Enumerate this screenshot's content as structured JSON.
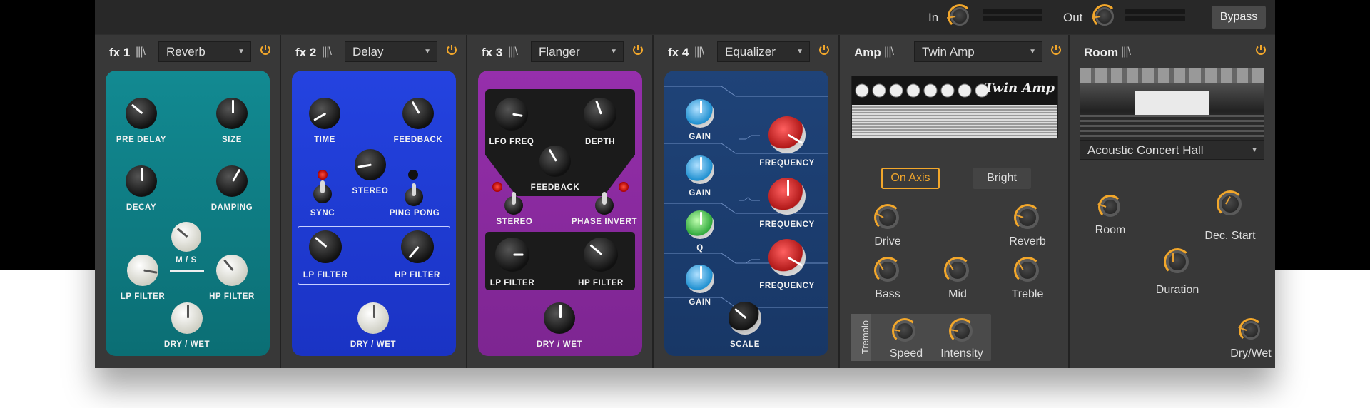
{
  "colors": {
    "accent": "#f2a72b",
    "reverb_pedal": "#0f7f86",
    "delay_pedal": "#1e3ad6",
    "flanger_pedal": "#8c2a9f",
    "eq_pedal": "#1d3d6e"
  },
  "topbar": {
    "in_label": "In",
    "out_label": "Out",
    "bypass_label": "Bypass"
  },
  "fx1": {
    "label": "fx 1",
    "grip": "|||\\",
    "preset": "Reverb",
    "knobs": {
      "pre_delay": "PRE DELAY",
      "size": "SIZE",
      "decay": "DECAY",
      "damping": "DAMPING",
      "ms": "M / S",
      "lp_filter": "LP FILTER",
      "hp_filter": "HP FILTER",
      "dry_wet": "DRY / WET"
    }
  },
  "fx2": {
    "label": "fx 2",
    "grip": "|||\\",
    "preset": "Delay",
    "knobs": {
      "time": "TIME",
      "feedback": "FEEDBACK",
      "stereo": "STEREO",
      "sync": "SYNC",
      "ping_pong": "PING PONG",
      "lp_filter": "LP FILTER",
      "hp_filter": "HP FILTER",
      "dry_wet": "DRY / WET"
    }
  },
  "fx3": {
    "label": "fx 3",
    "grip": "|||\\",
    "preset": "Flanger",
    "knobs": {
      "lfo_freq": "LFO FREQ",
      "depth": "DEPTH",
      "feedback": "FEEDBACK",
      "stereo": "STEREO",
      "phase_invert": "PHASE INVERT",
      "lp_filter": "LP FILTER",
      "hp_filter": "HP FILTER",
      "dry_wet": "DRY / WET"
    }
  },
  "fx4": {
    "label": "fx 4",
    "grip": "|||\\",
    "preset": "Equalizer",
    "knobs": {
      "gain1": "GAIN",
      "gain2": "GAIN",
      "q": "Q",
      "gain3": "GAIN",
      "freq1": "FREQUENCY",
      "freq2": "FREQUENCY",
      "freq3": "FREQUENCY",
      "scale": "SCALE"
    }
  },
  "amp": {
    "label": "Amp",
    "grip": "|||\\",
    "preset": "Twin Amp",
    "image_logo": "Twin Amp",
    "on_axis": "On Axis",
    "bright": "Bright",
    "knobs": {
      "drive": "Drive",
      "reverb": "Reverb",
      "bass": "Bass",
      "mid": "Mid",
      "treble": "Treble"
    },
    "tremolo": {
      "label": "Tremolo",
      "speed": "Speed",
      "intensity": "Intensity"
    }
  },
  "room": {
    "label": "Room",
    "grip": "|||\\",
    "preset": "Acoustic Concert Hall",
    "knobs": {
      "room": "Room",
      "dec_start": "Dec. Start",
      "duration": "Duration",
      "dry_wet": "Dry/Wet"
    }
  }
}
